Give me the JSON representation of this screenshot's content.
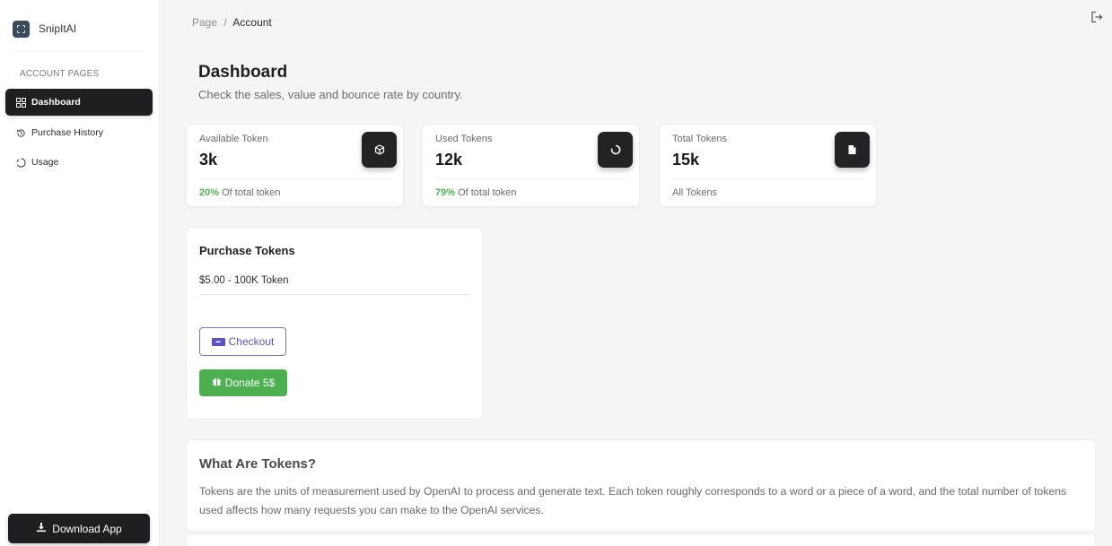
{
  "brand": {
    "name": "SnipItAI"
  },
  "sidebar": {
    "section_title": "ACCOUNT PAGES",
    "items": [
      {
        "label": "Dashboard",
        "icon": "grid-icon",
        "active": true
      },
      {
        "label": "Purchase History",
        "icon": "history-icon",
        "active": false
      },
      {
        "label": "Usage",
        "icon": "loading-circle-icon",
        "active": false
      }
    ],
    "download_label": "Download App"
  },
  "breadcrumb": {
    "root": "Page",
    "separator": "/",
    "current": "Account"
  },
  "header": {
    "title": "Dashboard",
    "subtitle": "Check the sales, value and bounce rate by country."
  },
  "stats": [
    {
      "label": "Available Token",
      "value": "3k",
      "pct": "20%",
      "foot": " Of total token",
      "icon": "cube-icon"
    },
    {
      "label": "Used Tokens",
      "value": "12k",
      "pct": "79%",
      "foot": " Of total token",
      "icon": "spinner-icon"
    },
    {
      "label": "Total Tokens",
      "value": "15k",
      "pct": "",
      "foot": "All Tokens",
      "icon": "document-icon"
    }
  ],
  "purchase": {
    "title": "Purchase Tokens",
    "price": "$5.00 - 100K Token",
    "checkout_label": "Checkout",
    "donate_label": "Donate 5$"
  },
  "info": {
    "title": "What Are Tokens?",
    "body": "Tokens are the units of measurement used by OpenAI to process and generate text. Each token roughly corresponds to a word or a piece of a word, and the total number of tokens used affects how many requests you can make to the OpenAI services."
  },
  "colors": {
    "accent_dark": "#1f1f21",
    "success": "#4caf50",
    "stripe": "#5a52c8"
  }
}
